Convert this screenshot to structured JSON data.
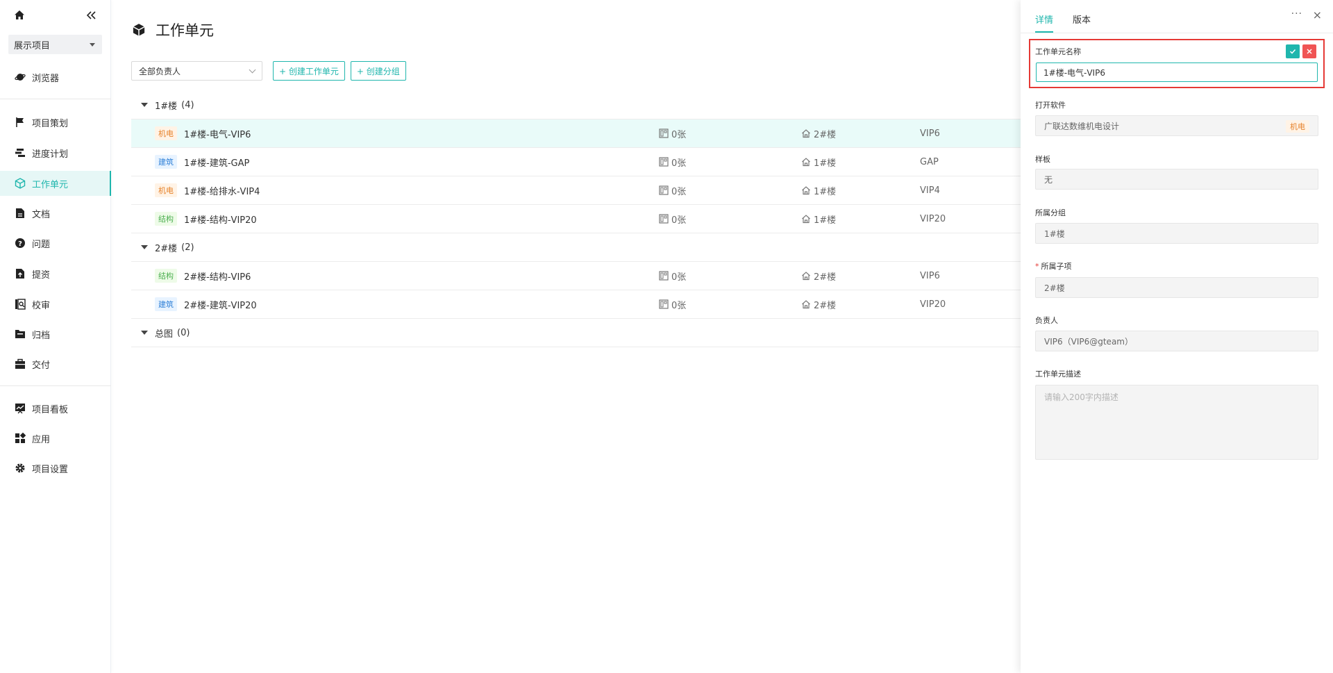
{
  "sidebar": {
    "project_select": "展示项目",
    "items": [
      {
        "label": "浏览器"
      },
      {
        "label": "项目策划"
      },
      {
        "label": "进度计划"
      },
      {
        "label": "工作单元"
      },
      {
        "label": "文档"
      },
      {
        "label": "问题"
      },
      {
        "label": "提资"
      },
      {
        "label": "校审"
      },
      {
        "label": "归档"
      },
      {
        "label": "交付"
      },
      {
        "label": "项目看板"
      },
      {
        "label": "应用"
      },
      {
        "label": "项目设置"
      }
    ]
  },
  "main": {
    "title": "工作单元",
    "filter_value": "全部负责人",
    "btn_create_unit": "+ 创建工作单元",
    "btn_create_group": "+ 创建分组",
    "groups": [
      {
        "name": "1#楼",
        "count": "(4)",
        "rows": [
          {
            "tag": "机电",
            "name": "1#楼-电气-VIP6",
            "drawings": "0张",
            "building": "2#楼",
            "owner": "VIP6"
          },
          {
            "tag": "建筑",
            "name": "1#楼-建筑-GAP",
            "drawings": "0张",
            "building": "1#楼",
            "owner": "GAP"
          },
          {
            "tag": "机电",
            "name": "1#楼-给排水-VIP4",
            "drawings": "0张",
            "building": "1#楼",
            "owner": "VIP4"
          },
          {
            "tag": "结构",
            "name": "1#楼-结构-VIP20",
            "drawings": "0张",
            "building": "1#楼",
            "owner": "VIP20"
          }
        ]
      },
      {
        "name": "2#楼",
        "count": "(2)",
        "rows": [
          {
            "tag": "结构",
            "name": "2#楼-结构-VIP6",
            "drawings": "0张",
            "building": "2#楼",
            "owner": "VIP6"
          },
          {
            "tag": "建筑",
            "name": "2#楼-建筑-VIP20",
            "drawings": "0张",
            "building": "2#楼",
            "owner": "VIP20"
          }
        ]
      },
      {
        "name": "总图",
        "count": "(0)",
        "rows": []
      }
    ]
  },
  "panel": {
    "tabs": [
      "详情",
      "版本"
    ],
    "more": "···",
    "close": "×",
    "fields": {
      "name_label": "工作单元名称",
      "name_value": "1#楼-电气-VIP6",
      "software_label": "打开软件",
      "software_value": "广联达数维机电设计",
      "software_badge": "机电",
      "template_label": "样板",
      "template_value": "无",
      "group_label": "所属分组",
      "group_value": "1#楼",
      "subitem_required": "*",
      "subitem_label": "所属子项",
      "subitem_value": "2#楼",
      "owner_label": "负责人",
      "owner_value": "VIP6（VIP6@gteam）",
      "desc_label": "工作单元描述",
      "desc_placeholder": "请输入200字内描述"
    }
  },
  "colors": {
    "accent": "#1fb6ad",
    "danger": "#e53935"
  }
}
